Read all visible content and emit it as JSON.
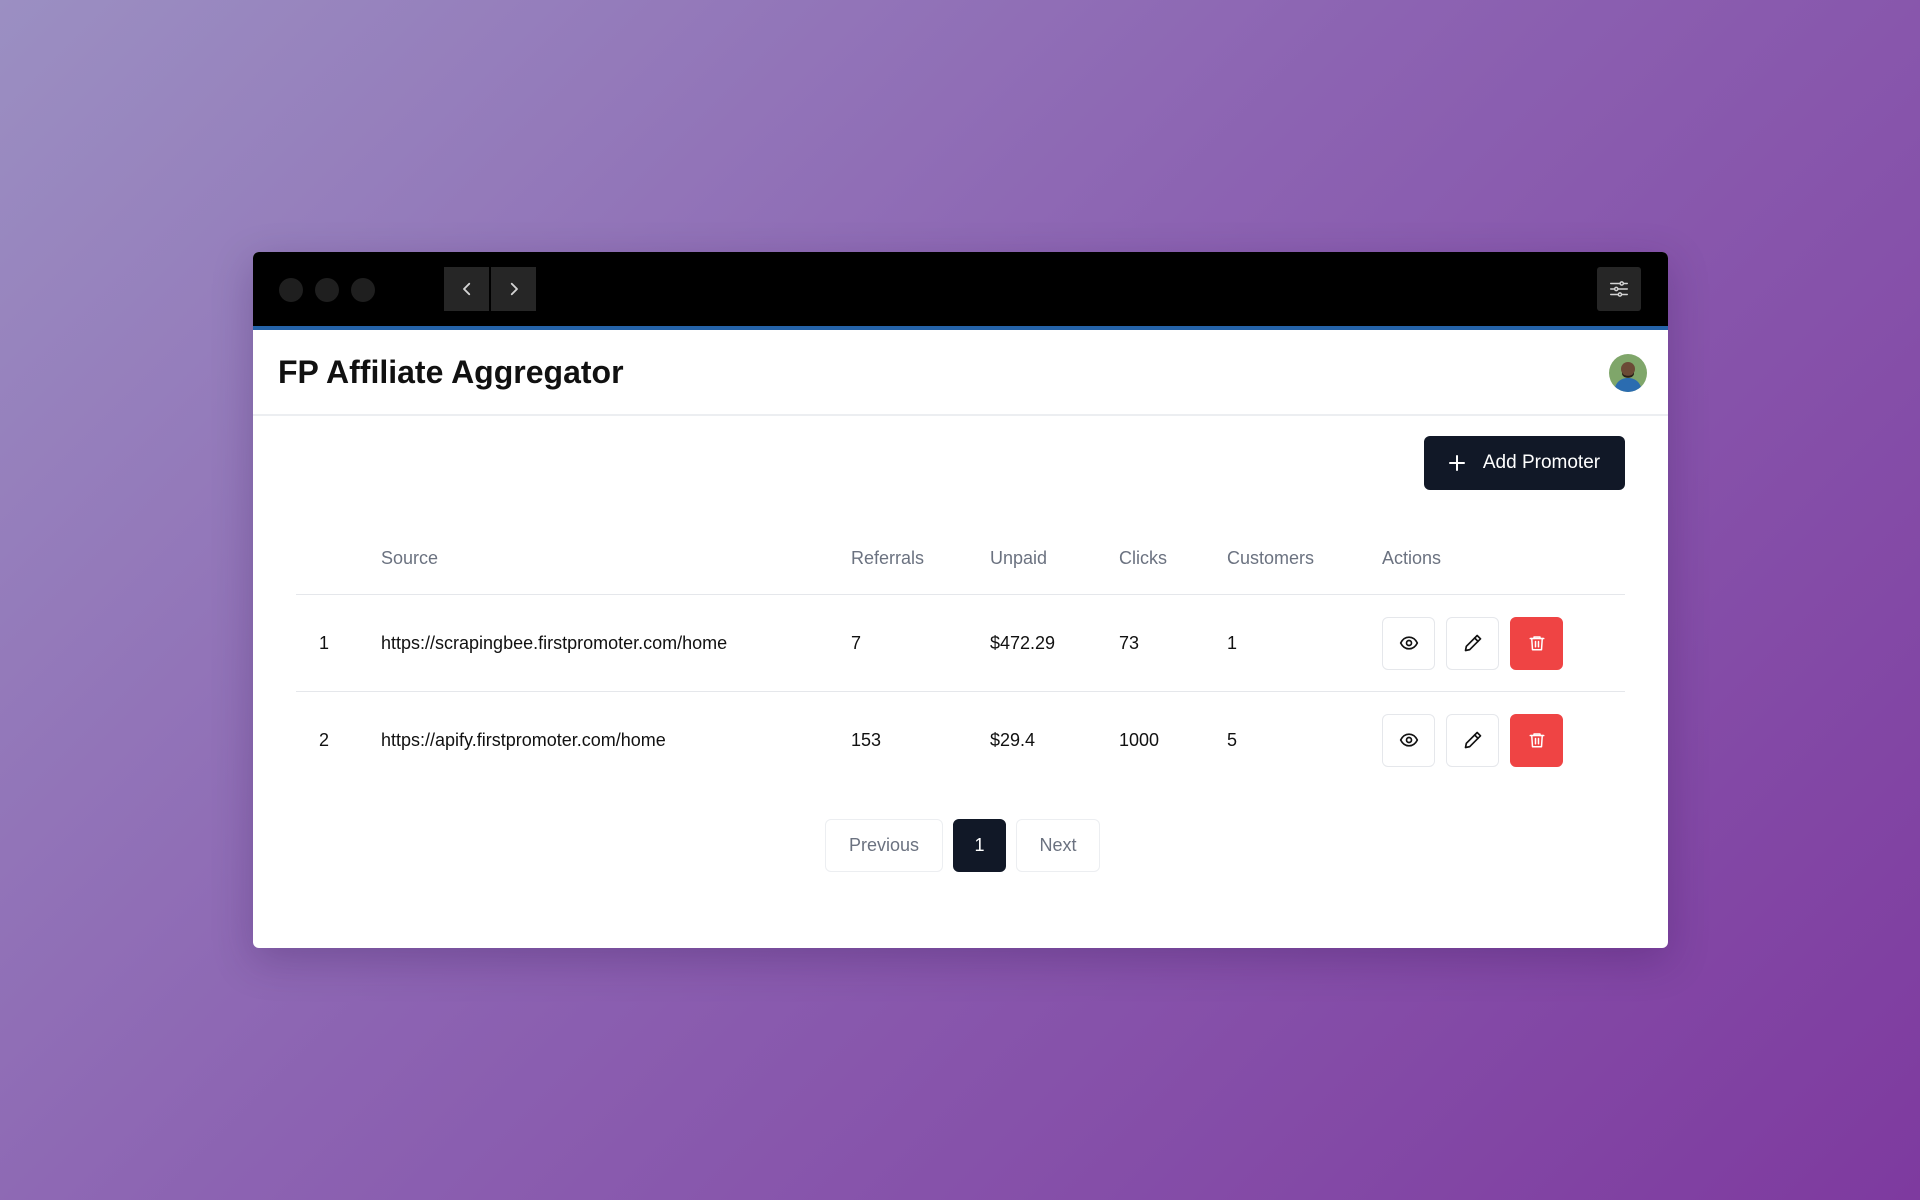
{
  "app": {
    "title": "FP Affiliate Aggregator"
  },
  "toolbar": {
    "add_label": "Add Promoter"
  },
  "table": {
    "headers": {
      "index": "",
      "source": "Source",
      "referrals": "Referrals",
      "unpaid": "Unpaid",
      "clicks": "Clicks",
      "customers": "Customers",
      "actions": "Actions"
    },
    "rows": [
      {
        "index": "1",
        "source": "https://scrapingbee.firstpromoter.com/home",
        "referrals": "7",
        "unpaid": "$472.29",
        "clicks": "73",
        "customers": "1"
      },
      {
        "index": "2",
        "source": "https://apify.firstpromoter.com/home",
        "referrals": "153",
        "unpaid": "$29.4",
        "clicks": "1000",
        "customers": "5"
      }
    ]
  },
  "pagination": {
    "previous": "Previous",
    "current": "1",
    "next": "Next"
  },
  "icons": {
    "back": "chevron-left-icon",
    "forward": "chevron-right-icon",
    "settings": "sliders-icon",
    "add": "plus-icon",
    "view": "eye-icon",
    "edit": "pencil-icon",
    "delete": "trash-icon"
  },
  "colors": {
    "primary": "#111827",
    "danger": "#ef4444",
    "titlebar_accent": "#2563a8",
    "muted_text": "#6b7280"
  }
}
